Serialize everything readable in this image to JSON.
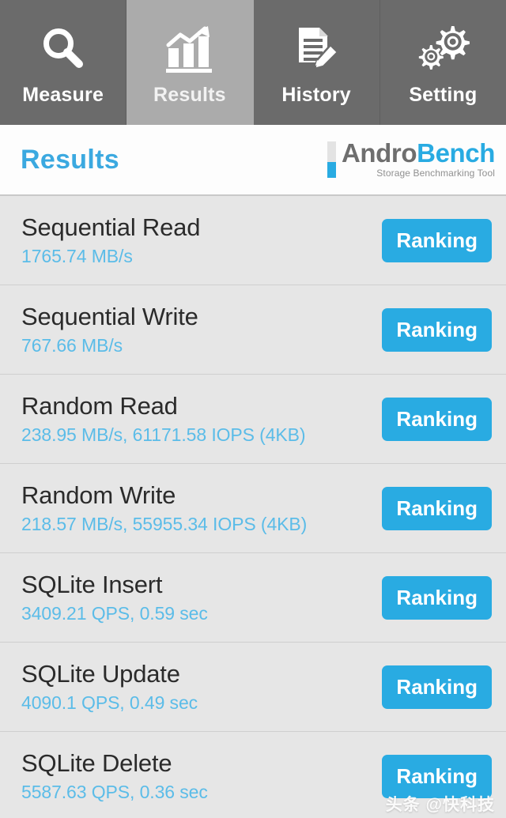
{
  "tabbar": {
    "tabs": [
      {
        "label": "Measure",
        "icon": "magnifier-icon",
        "active": false
      },
      {
        "label": "Results",
        "icon": "bar-chart-trend-icon",
        "active": true
      },
      {
        "label": "History",
        "icon": "document-pencil-icon",
        "active": false
      },
      {
        "label": "Setting",
        "icon": "gears-icon",
        "active": false
      }
    ]
  },
  "header": {
    "title": "Results",
    "logo": {
      "word_primary": "Andro",
      "word_secondary": "Bench",
      "tagline": "Storage Benchmarking Tool"
    }
  },
  "results": {
    "ranking_label": "Ranking",
    "rows": [
      {
        "label": "Sequential Read",
        "value": "1765.74 MB/s"
      },
      {
        "label": "Sequential Write",
        "value": "767.66 MB/s"
      },
      {
        "label": "Random Read",
        "value": "238.95 MB/s, 61171.58 IOPS (4KB)"
      },
      {
        "label": "Random Write",
        "value": "218.57 MB/s, 55955.34 IOPS (4KB)"
      },
      {
        "label": "SQLite Insert",
        "value": "3409.21 QPS, 0.59 sec"
      },
      {
        "label": "SQLite Update",
        "value": "4090.1 QPS, 0.49 sec"
      },
      {
        "label": "SQLite Delete",
        "value": "5587.63 QPS, 0.36 sec"
      }
    ]
  },
  "watermark": {
    "text": "头条 @快科技"
  },
  "colors": {
    "accent_blue": "#29abe2",
    "title_blue": "#3ba9e0",
    "value_blue": "#5bbce8",
    "tab_inactive": "#6b6b6b",
    "tab_active": "#ababab",
    "list_bg": "#e6e6e6"
  }
}
